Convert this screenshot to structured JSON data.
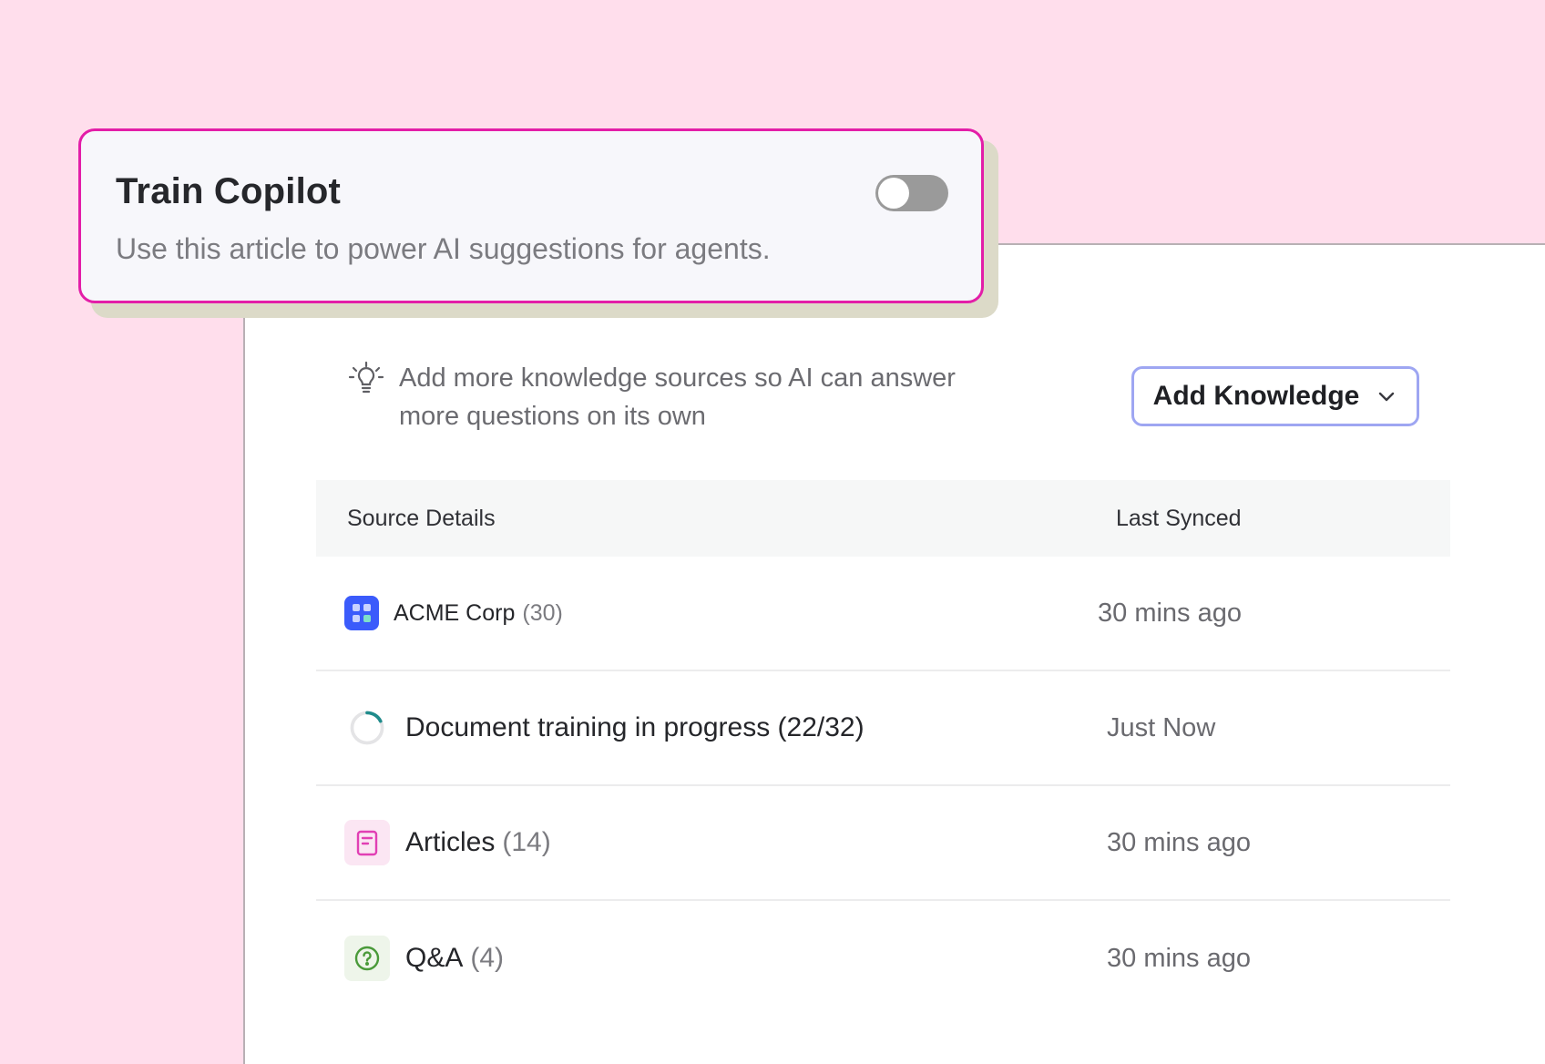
{
  "card": {
    "title": "Train Copilot",
    "subtitle": "Use this article to power AI suggestions for agents.",
    "toggle_on": false
  },
  "hint": {
    "icon": "lightbulb-icon",
    "line1": "Add more knowledge sources so AI can answer",
    "line2": "more questions on its own"
  },
  "add_button": {
    "label": "Add Knowledge",
    "icon": "chevron-down-icon"
  },
  "table": {
    "headers": [
      "Source Details",
      "Last Synced"
    ],
    "rows": [
      {
        "name": "ACME Corp",
        "count": "(30)",
        "synced": "30 mins ago",
        "icon": "app-grid-icon"
      },
      {
        "name": "Document training in progress (22/32)",
        "count": "",
        "synced": "Just Now",
        "icon": "progress-spinner-icon"
      },
      {
        "name": "Articles",
        "count": "(14)",
        "synced": "30 mins ago",
        "icon": "document-icon"
      },
      {
        "name": "Q&A",
        "count": "(4)",
        "synced": "30 mins ago",
        "icon": "question-icon"
      }
    ]
  },
  "colors": {
    "background": "#ffdeec",
    "card_border": "#e31ea8",
    "button_border": "#9ea6f2",
    "acme_icon": "#3b5bfb",
    "articles_icon": "#e13fb4",
    "qa_icon": "#4a9a3a",
    "spinner": "#1f8b8b"
  }
}
